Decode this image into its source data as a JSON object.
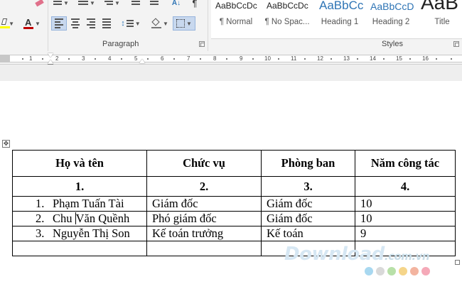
{
  "ribbon": {
    "paragraph_group_label": "Paragraph",
    "styles_group_label": "Styles",
    "styles": [
      {
        "preview": "AaBbCcDc",
        "name": "¶ Normal"
      },
      {
        "preview": "AaBbCcDc",
        "name": "¶ No Spac..."
      },
      {
        "preview": "AaBbCc",
        "name": "Heading 1"
      },
      {
        "preview": "AaBbCcD",
        "name": "Heading 2"
      },
      {
        "preview": "AaB",
        "name": "Title"
      }
    ],
    "colors": {
      "font_color": "#c00000",
      "highlight_color": "#ffff00",
      "heading_blue": "#2e74b5",
      "selected_bg": "#c8d8ee"
    }
  },
  "ruler": {
    "numbers": [
      "1",
      "2",
      "3",
      "4",
      "5",
      "6",
      "7",
      "8",
      "9",
      "10",
      "11",
      "12",
      "13",
      "14",
      "15",
      "16"
    ]
  },
  "table": {
    "headers": [
      "Họ và tên",
      "Chức vụ",
      "Phòng ban",
      "Năm công tác"
    ],
    "numbering": [
      "1.",
      "2.",
      "3.",
      "4."
    ],
    "rows": [
      {
        "index": "1.",
        "name": "Phạm Tuấn Tài",
        "position": "Giám đốc",
        "department": "Giám đốc",
        "years": "10"
      },
      {
        "index": "2.",
        "name_before_cursor": "Chu ",
        "name_after_cursor": "Văn Quềnh",
        "position": "Phó giám đốc",
        "department": "Giám đốc",
        "years": "10"
      },
      {
        "index": "3.",
        "name": "Nguyễn Thị Son",
        "position": "Kế toán trưởng",
        "department": "Kế toán",
        "years": "9"
      }
    ]
  },
  "watermark": {
    "text": "Download",
    "suffix": ".com.vn",
    "dot_colors": [
      "#a8d8f0",
      "#d9d9d9",
      "#b8e0a8",
      "#f5d58a",
      "#f3b4a0",
      "#f5a9b8"
    ]
  }
}
